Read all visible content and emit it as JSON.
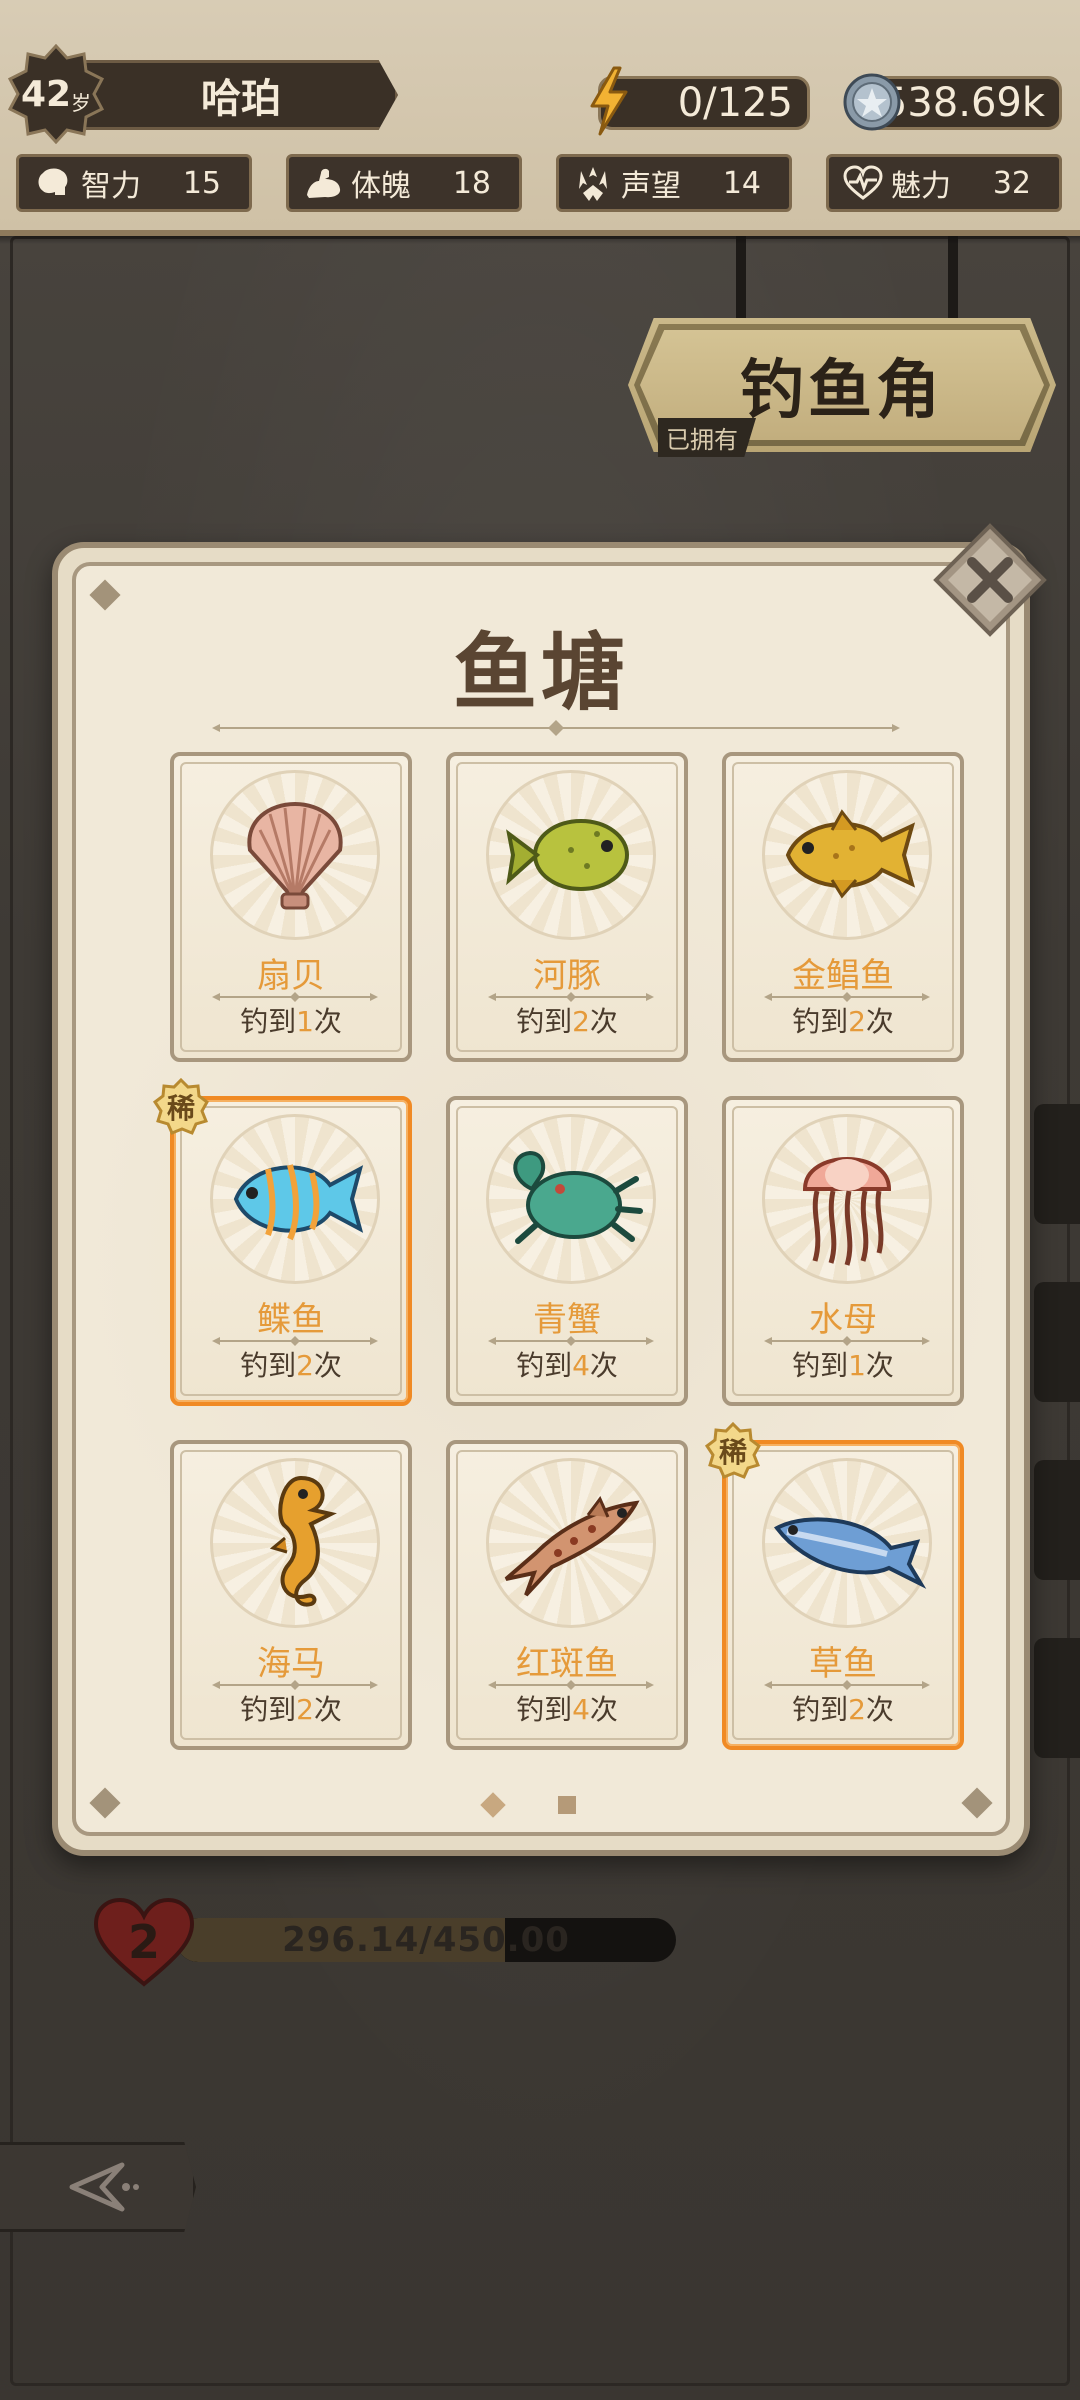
{
  "player": {
    "age": "42",
    "age_unit": "岁",
    "name": "哈珀"
  },
  "resources": {
    "energy": "0/125",
    "currency": "538.69k"
  },
  "stats": [
    {
      "label": "智力",
      "value": "15",
      "icon": "brain-icon"
    },
    {
      "label": "体魄",
      "value": "18",
      "icon": "muscle-arm-icon"
    },
    {
      "label": "声望",
      "value": "14",
      "icon": "crown-laurel-icon"
    },
    {
      "label": "魅力",
      "value": "32",
      "icon": "heartbeat-icon"
    }
  ],
  "location": {
    "title": "钓鱼角",
    "owned_label": "已拥有"
  },
  "health": {
    "level": "2",
    "text": "296.14/450.00",
    "fraction": 0.658
  },
  "dialog": {
    "title": "鱼塘",
    "catch_prefix": "钓到",
    "catch_suffix": "次",
    "rare_label": "稀",
    "page_count": 2,
    "active_page": 1,
    "items": [
      {
        "name": "扇贝",
        "count": "1",
        "rare": false,
        "icon": "scallop-icon"
      },
      {
        "name": "河豚",
        "count": "2",
        "rare": false,
        "icon": "pufferfish-icon"
      },
      {
        "name": "金鲳鱼",
        "count": "2",
        "rare": false,
        "icon": "golden-pompano-icon"
      },
      {
        "name": "鲽鱼",
        "count": "2",
        "rare": true,
        "icon": "angelfish-icon"
      },
      {
        "name": "青蟹",
        "count": "4",
        "rare": false,
        "icon": "green-crab-icon"
      },
      {
        "name": "水母",
        "count": "1",
        "rare": false,
        "icon": "jellyfish-icon"
      },
      {
        "name": "海马",
        "count": "2",
        "rare": false,
        "icon": "seahorse-icon"
      },
      {
        "name": "红斑鱼",
        "count": "4",
        "rare": false,
        "icon": "red-spotted-fish-icon"
      },
      {
        "name": "草鱼",
        "count": "2",
        "rare": true,
        "icon": "grass-carp-icon"
      }
    ]
  },
  "colors": {
    "rare_border": "#f08a24",
    "name_text": "#e59a3a",
    "hud_bg": "#d8ccb5"
  }
}
